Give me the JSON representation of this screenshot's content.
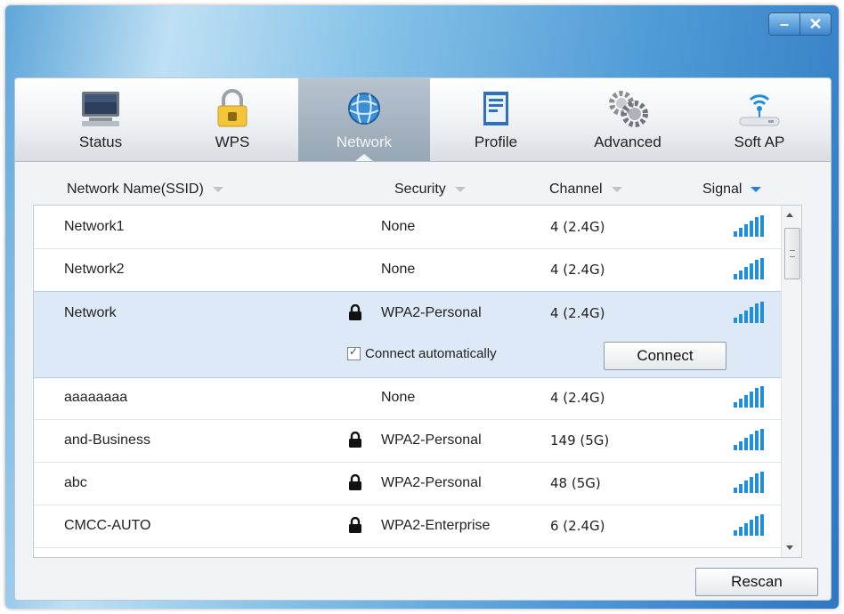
{
  "window": {
    "minimize_label": "–",
    "close_label": "✕"
  },
  "tabs": [
    {
      "label": "Status",
      "icon": "monitor-icon"
    },
    {
      "label": "WPS",
      "icon": "padlock-icon"
    },
    {
      "label": "Network",
      "icon": "globe-icon",
      "active": true
    },
    {
      "label": "Profile",
      "icon": "profile-card-icon"
    },
    {
      "label": "Advanced",
      "icon": "gears-icon"
    },
    {
      "label": "Soft AP",
      "icon": "router-icon"
    }
  ],
  "columns": {
    "ssid": "Network Name(SSID)",
    "security": "Security",
    "channel": "Channel",
    "signal": "Signal"
  },
  "networks": [
    {
      "ssid": "Network1",
      "security": "None",
      "channel": "4 (2.4G)",
      "locked": false
    },
    {
      "ssid": "Network2",
      "security": "None",
      "channel": "4 (2.4G)",
      "locked": false
    },
    {
      "ssid": "Network",
      "security": "WPA2-Personal",
      "channel": "4 (2.4G)",
      "locked": true
    },
    {
      "ssid": "aaaaaaaa",
      "security": "None",
      "channel": "4 (2.4G)",
      "locked": false
    },
    {
      "ssid": "and-Business",
      "security": "WPA2-Personal",
      "channel": "149 (5G)",
      "locked": true
    },
    {
      "ssid": "abc",
      "security": "WPA2-Personal",
      "channel": "48 (5G)",
      "locked": true
    },
    {
      "ssid": "CMCC-AUTO",
      "security": "WPA2-Enterprise",
      "channel": "6 (2.4G)",
      "locked": true
    }
  ],
  "selected": {
    "auto_connect_label": "Connect automatically",
    "auto_connect_checked": true,
    "connect_label": "Connect"
  },
  "rescan_label": "Rescan",
  "colors": {
    "accent": "#2d7dd2",
    "selected_row": "#dde9f6",
    "signal": "#1e8fd8"
  }
}
